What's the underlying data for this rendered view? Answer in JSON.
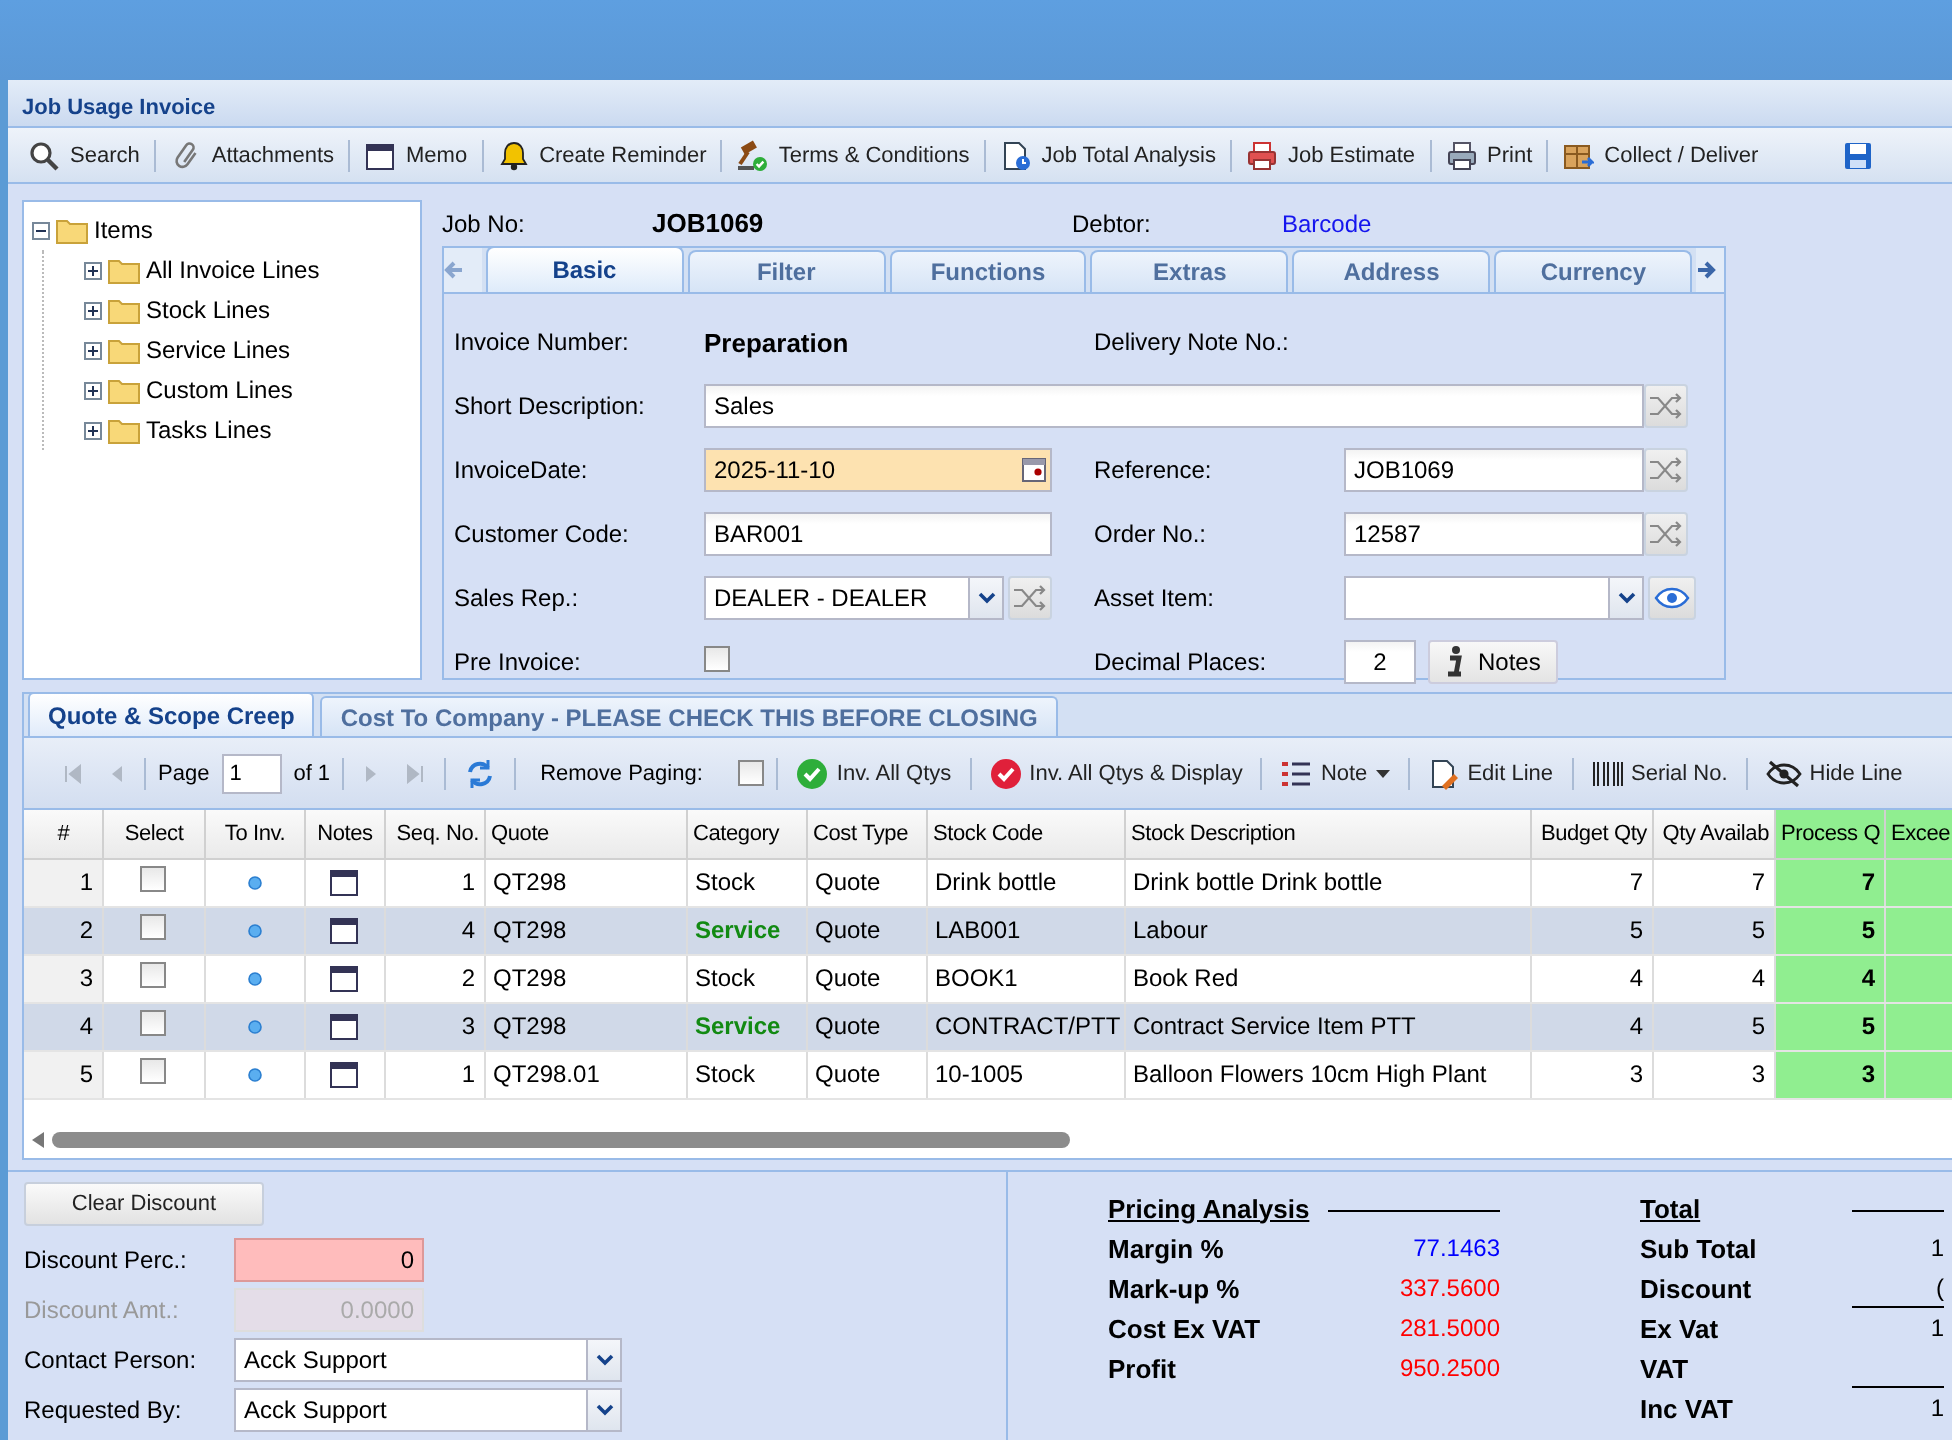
{
  "window": {
    "title": "Job Usage Invoice"
  },
  "toolbar": [
    {
      "label": "Search"
    },
    {
      "label": "Attachments"
    },
    {
      "label": "Memo"
    },
    {
      "label": "Create Reminder"
    },
    {
      "label": "Terms & Conditions"
    },
    {
      "label": "Job Total Analysis"
    },
    {
      "label": "Job Estimate"
    },
    {
      "label": "Print"
    },
    {
      "label": "Collect / Deliver"
    }
  ],
  "tree": {
    "label": "Items",
    "expanded": true,
    "children": [
      {
        "label": "All Invoice Lines",
        "expanded": false
      },
      {
        "label": "Stock Lines",
        "expanded": false
      },
      {
        "label": "Service Lines",
        "expanded": false
      },
      {
        "label": "Custom Lines",
        "expanded": false
      },
      {
        "label": "Tasks Lines",
        "expanded": false
      }
    ]
  },
  "job": {
    "job_no_label": "Job No:",
    "job_no": "JOB1069",
    "debtor_label": "Debtor:",
    "debtor": "Barcode"
  },
  "tabs": [
    {
      "label": "Basic",
      "selected": true
    },
    {
      "label": "Filter",
      "selected": false
    },
    {
      "label": "Functions",
      "selected": false
    },
    {
      "label": "Extras",
      "selected": false
    },
    {
      "label": "Address",
      "selected": false
    },
    {
      "label": "Currency",
      "selected": false
    }
  ],
  "form": [
    {
      "kind": "readonly",
      "label": "Invoice Number:",
      "value": "Preparation"
    },
    {
      "kind": "label",
      "label": "Delivery Note No.:"
    },
    {
      "kind": "wide",
      "label": "Short Description:",
      "value": "Sales"
    },
    {
      "kind": "date",
      "label": "InvoiceDate:",
      "value": "2025-11-10"
    },
    {
      "kind": "input-shuffle",
      "label": "Reference:",
      "value": "JOB1069"
    },
    {
      "kind": "input",
      "label": "Customer Code:",
      "value": "BAR001"
    },
    {
      "kind": "input-shuffle",
      "label": "Order No.:",
      "value": "12587"
    },
    {
      "kind": "select-shuffle",
      "label": "Sales Rep.:",
      "value": "DEALER - DEALER"
    },
    {
      "kind": "select-eye",
      "label": "Asset Item:"
    },
    {
      "kind": "checkbox",
      "label": "Pre Invoice:",
      "checked": false
    },
    {
      "kind": "decimal",
      "label": "Decimal Places:",
      "value": "2",
      "button": "Notes"
    }
  ],
  "grid_tabs": [
    {
      "label": "Quote & Scope Creep",
      "selected": true
    },
    {
      "label": "Cost To Company - PLEASE CHECK THIS BEFORE CLOSING",
      "selected": false
    }
  ],
  "grid_toolbar": {
    "page_label": "Page",
    "page": "1",
    "of_pages": "of 1",
    "remove_paging_label": "Remove Paging:",
    "remove_paging": false,
    "buttons": [
      "Inv. All Qtys",
      "Inv. All Qtys & Display",
      "Note",
      "Edit Line",
      "Serial No.",
      "Hide Line"
    ]
  },
  "columns": [
    {
      "label": "#",
      "kind": "rownum",
      "highlighted": false
    },
    {
      "label": "Select",
      "kind": "check",
      "highlighted": false
    },
    {
      "label": "To Inv.",
      "kind": "dot",
      "highlighted": false
    },
    {
      "label": "Notes",
      "kind": "notes",
      "highlighted": false
    },
    {
      "label": "Seq. No.",
      "kind": "number",
      "highlighted": false
    },
    {
      "label": "Quote",
      "kind": "text",
      "highlighted": false
    },
    {
      "label": "Category",
      "kind": "category",
      "highlighted": false
    },
    {
      "label": "Cost Type",
      "kind": "text",
      "highlighted": false
    },
    {
      "label": "Stock Code",
      "kind": "text",
      "highlighted": false
    },
    {
      "label": "Stock Description",
      "kind": "text",
      "highlighted": false
    },
    {
      "label": "Budget Qty",
      "kind": "number",
      "highlighted": false
    },
    {
      "label": "Qty Availab",
      "kind": "number",
      "highlighted": false
    },
    {
      "label": "Process Q",
      "kind": "number",
      "highlighted": true
    },
    {
      "label": "Excee",
      "kind": "text",
      "highlighted": true
    }
  ],
  "rows": [
    {
      "highlighted": false,
      "cells": [
        "1",
        false,
        "",
        "",
        "1",
        "QT298",
        "Stock",
        "Quote",
        "Drink bottle",
        "Drink bottle Drink bottle",
        "7",
        "7",
        "7",
        ""
      ]
    },
    {
      "highlighted": true,
      "cells": [
        "2",
        false,
        "",
        "",
        "4",
        "QT298",
        "Service",
        "Quote",
        "LAB001",
        "Labour",
        "5",
        "5",
        "5",
        ""
      ]
    },
    {
      "highlighted": false,
      "cells": [
        "3",
        false,
        "",
        "",
        "2",
        "QT298",
        "Stock",
        "Quote",
        "BOOK1",
        "Book Red",
        "4",
        "4",
        "4",
        ""
      ]
    },
    {
      "highlighted": true,
      "cells": [
        "4",
        false,
        "",
        "",
        "3",
        "QT298",
        "Service",
        "Quote",
        "CONTRACT/PTT",
        "Contract Service Item PTT",
        "4",
        "5",
        "5",
        ""
      ]
    },
    {
      "highlighted": false,
      "cells": [
        "5",
        false,
        "",
        "",
        "1",
        "QT298.01",
        "Stock",
        "Quote",
        "10-1005",
        "Balloon Flowers 10cm High Plant",
        "3",
        "3",
        "3",
        ""
      ]
    }
  ],
  "discount": {
    "button": "Clear Discount",
    "fields": [
      {
        "kind": "invalid",
        "label": "Discount Perc.:",
        "value": "0",
        "disabled": false
      },
      {
        "kind": "number",
        "label": "Discount Amt.:",
        "value": "0.0000",
        "disabled": true
      },
      {
        "kind": "select",
        "label": "Contact Person:",
        "value": "Acck Support",
        "disabled": false
      },
      {
        "kind": "select",
        "label": "Requested By:",
        "value": "Acck Support",
        "disabled": false
      }
    ]
  },
  "pricing": {
    "title": "Pricing Analysis",
    "items": [
      {
        "label": "Margin %",
        "value": "77.1463",
        "color": "#0000ff"
      },
      {
        "label": "Mark-up %",
        "value": "337.5600",
        "color": "#ff0000"
      },
      {
        "label": "Cost Ex VAT",
        "value": "281.5000",
        "color": "#ff0000"
      },
      {
        "label": "Profit",
        "value": "950.2500",
        "color": "#ff0000"
      }
    ]
  },
  "total": {
    "title": "Total",
    "items": [
      {
        "label": "Sub Total",
        "value": "1",
        "rule": false
      },
      {
        "label": "Discount",
        "value": "(",
        "rule": true
      },
      {
        "label": "Ex Vat",
        "value": "1",
        "rule": false
      },
      {
        "label": "VAT",
        "rule": true
      },
      {
        "label": "Inc VAT",
        "value": "1",
        "rule": false
      }
    ]
  }
}
